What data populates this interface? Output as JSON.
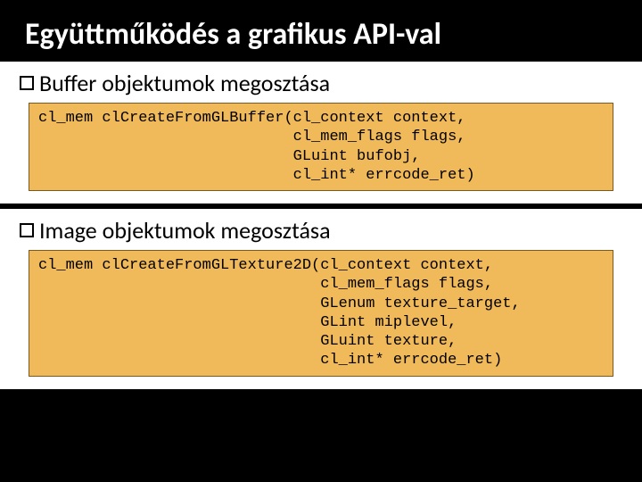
{
  "title": "Együttműködés a grafikus API-val",
  "section1": {
    "heading": "Buffer objektumok megosztása",
    "code": "cl_mem clCreateFromGLBuffer(cl_context context,\n                            cl_mem_flags flags,\n                            GLuint bufobj,\n                            cl_int* errcode_ret)"
  },
  "section2": {
    "heading": "Image objektumok megosztása",
    "code": "cl_mem clCreateFromGLTexture2D(cl_context context,\n                               cl_mem_flags flags,\n                               GLenum texture_target,\n                               GLint miplevel,\n                               GLuint texture,\n                               cl_int* errcode_ret)"
  }
}
